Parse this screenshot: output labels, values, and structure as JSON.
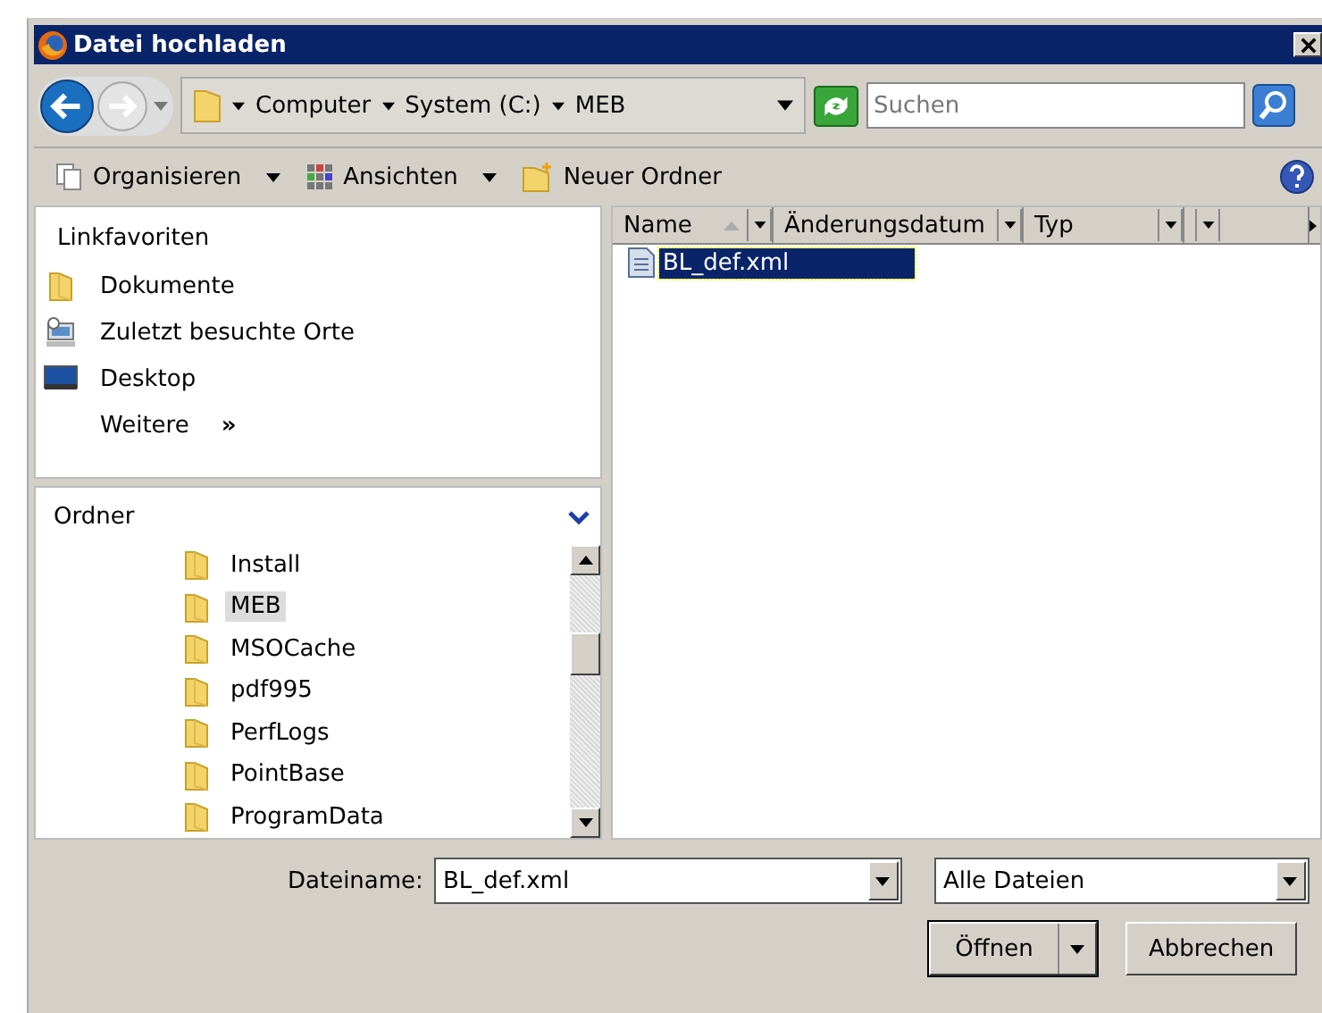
{
  "window": {
    "title": "Datei hochladen"
  },
  "address": {
    "path": [
      {
        "label": "Computer"
      },
      {
        "label": "System (C:)"
      },
      {
        "label": "MEB"
      }
    ]
  },
  "search": {
    "placeholder": "Suchen"
  },
  "toolbar": [
    {
      "label": "Organisieren",
      "kind": "pages",
      "dropdown": true
    },
    {
      "label": "Ansichten",
      "kind": "grid",
      "dropdown": true
    },
    {
      "label": "Neuer Ordner",
      "kind": "newfolder",
      "dropdown": false
    }
  ],
  "favorites": {
    "title": "Linkfavoriten",
    "items": [
      {
        "label": "Dokumente",
        "kind": "folder"
      },
      {
        "label": "Zuletzt besuchte Orte",
        "kind": "recent"
      },
      {
        "label": "Desktop",
        "kind": "desktop"
      }
    ],
    "more": "Weitere",
    "more_glyph": "»"
  },
  "folders": {
    "title": "Ordner",
    "items": [
      {
        "label": "Install",
        "selected": false
      },
      {
        "label": "MEB",
        "selected": true
      },
      {
        "label": "MSOCache",
        "selected": false
      },
      {
        "label": "pdf995",
        "selected": false
      },
      {
        "label": "PerfLogs",
        "selected": false
      },
      {
        "label": "PointBase",
        "selected": false
      },
      {
        "label": "ProgramData",
        "selected": false
      }
    ]
  },
  "file_list": {
    "columns": [
      {
        "label": "Name",
        "sorted": true
      },
      {
        "label": "Änderungsdatum",
        "sorted": false
      },
      {
        "label": "Typ",
        "sorted": false
      }
    ],
    "rows": [
      {
        "name": "BL_def.xml",
        "selected": true
      }
    ]
  },
  "filename": {
    "label": "Dateiname:",
    "value": "BL_def.xml"
  },
  "filetype": {
    "value": "Alle Dateien"
  },
  "buttons": [
    {
      "label": "Öffnen",
      "kind": "split"
    },
    {
      "label": "Abbrechen",
      "kind": "plain"
    }
  ]
}
